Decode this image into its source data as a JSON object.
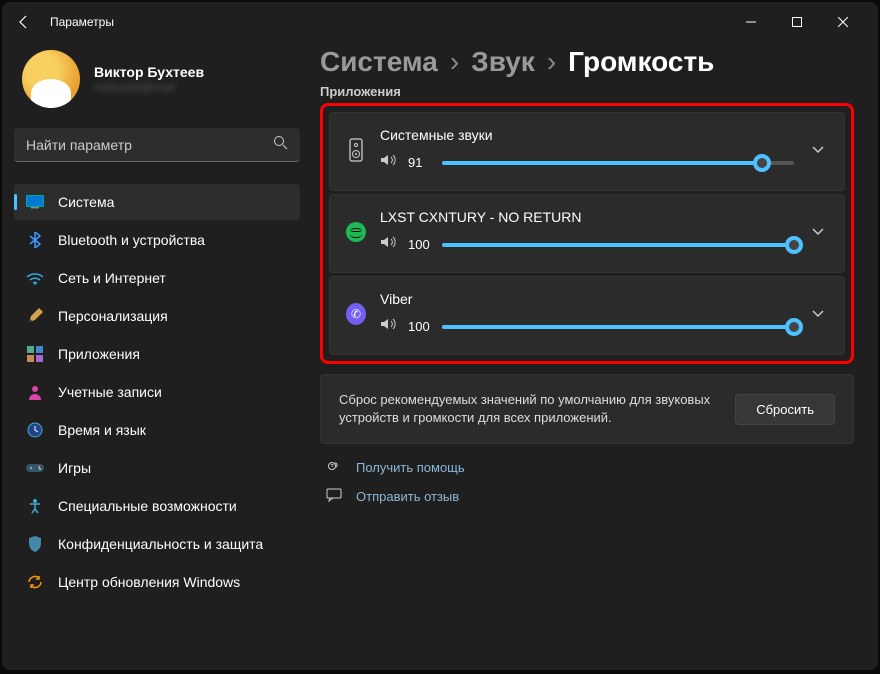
{
  "titlebar": {
    "title": "Параметры"
  },
  "profile": {
    "name": "Виктор Бухтеев",
    "sub": "redacted@mail"
  },
  "search": {
    "placeholder": "Найти параметр"
  },
  "nav": [
    {
      "label": "Система",
      "icon": "system",
      "active": true
    },
    {
      "label": "Bluetooth и устройства",
      "icon": "bluetooth"
    },
    {
      "label": "Сеть и Интернет",
      "icon": "network"
    },
    {
      "label": "Персонализация",
      "icon": "personalization"
    },
    {
      "label": "Приложения",
      "icon": "apps"
    },
    {
      "label": "Учетные записи",
      "icon": "accounts"
    },
    {
      "label": "Время и язык",
      "icon": "time"
    },
    {
      "label": "Игры",
      "icon": "gaming"
    },
    {
      "label": "Специальные возможности",
      "icon": "accessibility"
    },
    {
      "label": "Конфиденциальность и защита",
      "icon": "privacy"
    },
    {
      "label": "Центр обновления Windows",
      "icon": "update"
    }
  ],
  "breadcrumb": {
    "l1": "Система",
    "l2": "Звук",
    "l3": "Громкость"
  },
  "section_label": "Приложения",
  "apps": [
    {
      "title": "Системные звуки",
      "volume": 91,
      "icon": "speaker"
    },
    {
      "title": "LXST CXNTURY - NO RETURN",
      "volume": 100,
      "icon": "spotify"
    },
    {
      "title": "Viber",
      "volume": 100,
      "icon": "viber"
    }
  ],
  "reset": {
    "text": "Сброс рекомендуемых значений по умолчанию для звуковых устройств и громкости для всех приложений.",
    "button": "Сбросить"
  },
  "footer": {
    "help": "Получить помощь",
    "feedback": "Отправить отзыв"
  }
}
